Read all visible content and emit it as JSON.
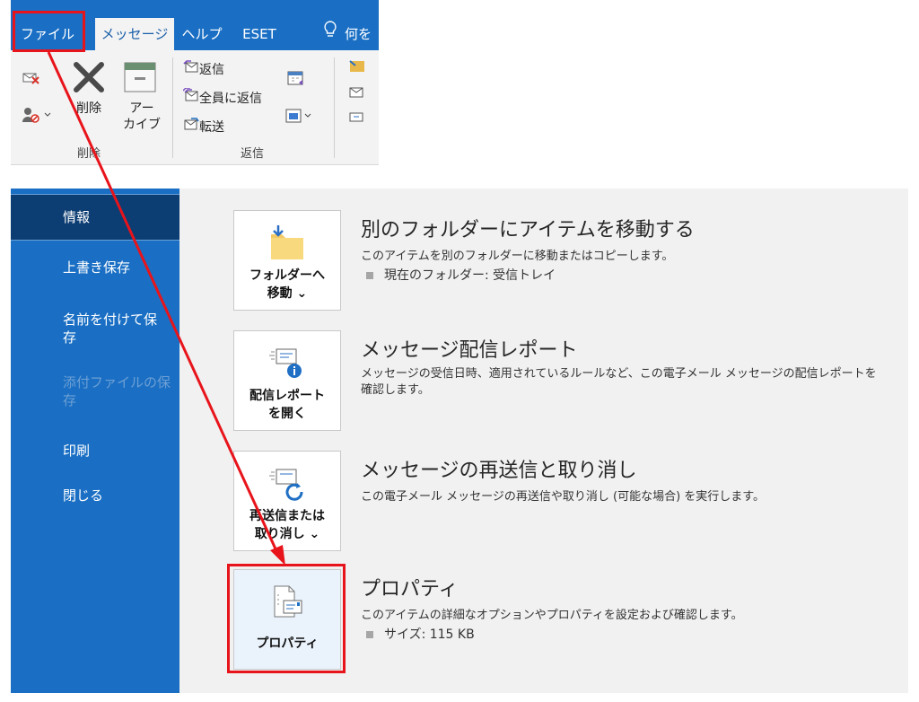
{
  "ribbon": {
    "tabs": {
      "file": "ファイル",
      "message": "メッセージ",
      "help": "ヘルプ",
      "eset": "ESET",
      "search": "何を"
    },
    "delete_group": {
      "delete_label": "削除",
      "archive_line1": "アー",
      "archive_line2": "カイブ",
      "group_label": "削除"
    },
    "reply_group": {
      "reply": "返信",
      "reply_all": "全員に返信",
      "forward": "転送",
      "group_label": "返信"
    }
  },
  "backstage": {
    "sidebar": {
      "info": "情報",
      "save": "上書き保存",
      "save_as_line1": "名前を付けて保",
      "save_as_line2": "存",
      "save_attach_line1": "添付ファイルの保",
      "save_attach_line2": "存",
      "print": "印刷",
      "close": "閉じる"
    },
    "move": {
      "btn_line1": "フォルダーへ",
      "btn_line2": "移動 ⌄",
      "title": "別のフォルダーにアイテムを移動する",
      "desc": "このアイテムを別のフォルダーに移動またはコピーします。",
      "bullet": "現在のフォルダー:   受信トレイ"
    },
    "report": {
      "btn_line1": "配信レポート",
      "btn_line2": "を開く",
      "title": "メッセージ配信レポート",
      "desc_line1": "メッセージの受信日時、適用されているルールなど、この電子メール メッセージの配信レポートを",
      "desc_line2": "確認します。"
    },
    "resend": {
      "btn_line1": "再送信または",
      "btn_line2": "取り消し ⌄",
      "title": "メッセージの再送信と取り消し",
      "desc": "この電子メール メッセージの再送信や取り消し (可能な場合) を実行します。"
    },
    "properties": {
      "btn_label": "プロパティ",
      "title": "プロパティ",
      "desc": "このアイテムの詳細なオプションやプロパティを設定および確認します。",
      "bullet": "サイズ:   115 KB"
    }
  },
  "colors": {
    "accent": "#1a6fc4",
    "sidebar_active": "#0c3d73",
    "annotation": "#e8141b"
  },
  "icons": [
    "tab-lightbulb-icon",
    "ignore-icon",
    "delete-x-icon",
    "archive-box-icon",
    "block-sender-icon",
    "reply-icon",
    "reply-all-icon",
    "forward-icon",
    "meeting-icon",
    "more-respond-icon",
    "move-folder-icon",
    "delivery-report-icon",
    "resend-icon",
    "properties-icon"
  ]
}
